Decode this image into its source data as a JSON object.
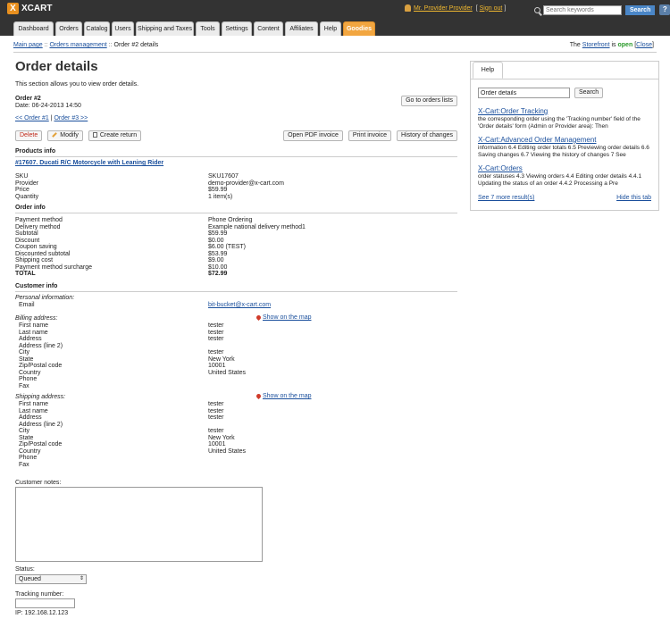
{
  "header": {
    "logo_text": "XCART",
    "user_name": "Mr. Provider Provider",
    "sign_out": "Sign out",
    "search_placeholder": "Search keywords",
    "search_button": "Search",
    "help_icon_label": "?"
  },
  "tabs": [
    "Dashboard",
    "Orders",
    "Catalog",
    "Users",
    "Shipping and Taxes",
    "Tools",
    "Settings",
    "Content",
    "Affiliates",
    "Help",
    "Goodies"
  ],
  "breadcrumb": {
    "main_page": "Main page",
    "sep": "::",
    "orders_management": "Orders management",
    "current": "Order #2 details"
  },
  "storefront": {
    "prefix": "The",
    "link": "Storefront",
    "middle": "is",
    "status": "open",
    "close_label": "Close"
  },
  "page": {
    "title": "Order details",
    "intro": "This section allows you to view order details.",
    "order_number": "Order #2",
    "order_date": "Date: 06-24-2013 14:50",
    "goto_orders": "Go to orders lists",
    "prev_order": "<< Order #1",
    "next_order": "Order #3 >>",
    "nav_sep": "|"
  },
  "actions": {
    "delete": "Delete",
    "modify": "Modify",
    "create_return": "Create return",
    "open_pdf": "Open PDF invoice",
    "print_invoice": "Print invoice",
    "history": "History of changes"
  },
  "products": {
    "section_title": "Products info",
    "product_link": "#17607. Ducati R/C Motorcycle with Leaning Rider",
    "labels": [
      "SKU",
      "Provider",
      "Price",
      "Quantity"
    ],
    "values": [
      "SKU17607",
      "demo-provider@x-cart.com",
      "$59.99",
      "1 item(s)"
    ]
  },
  "order_info": {
    "section_title": "Order info",
    "labels": [
      "Payment method",
      "Delivery method",
      "Subtotal",
      "Discount",
      "Coupon saving",
      "Discounted subtotal",
      "Shipping cost",
      "Payment method surcharge",
      "TOTAL"
    ],
    "values": [
      "Phone Ordering",
      "Example national delivery method1",
      "$59.99",
      "$0.00",
      "$6.00 (TEST)",
      "$53.99",
      "$9.00",
      "$10.00",
      "$72.99"
    ]
  },
  "customer_info": {
    "section_title": "Customer info",
    "personal_label": "Personal information:",
    "email_label": "Email",
    "email_value": "bit-bucket@x-cart.com",
    "billing_label": "Billing address:",
    "shipping_label": "Shipping address:",
    "show_map": "Show on the map",
    "address_labels": [
      "First name",
      "Last name",
      "Address",
      "Address (line 2)",
      "City",
      "State",
      "Zip/Postal code",
      "Country",
      "Phone",
      "Fax"
    ],
    "billing_values": [
      "tester",
      "tester",
      "tester",
      "",
      "tester",
      "New York",
      "10001",
      "United States",
      "",
      ""
    ],
    "shipping_values": [
      "tester",
      "tester",
      "tester",
      "",
      "tester",
      "New York",
      "10001",
      "United States",
      "",
      ""
    ]
  },
  "form": {
    "notes_label": "Customer notes:",
    "status_label": "Status:",
    "status_value": "Queued",
    "tracking_label": "Tracking number:",
    "ip": "IP: 192.168.12.123"
  },
  "help_panel": {
    "tab_label": "Help",
    "search_value": "Order details",
    "search_button": "Search",
    "results": [
      {
        "title": "X-Cart:Order Tracking",
        "snippet": "the corresponding order using the 'Tracking number' field of the 'Order details' form (Admin or Provider area): Then"
      },
      {
        "title": "X-Cart:Advanced Order Management",
        "snippet": "information 6.4 Editing order totals 6.5 Previewing order details 6.6 Saving changes 6.7 Viewing the history of changes 7 See"
      },
      {
        "title": "X-Cart:Orders",
        "snippet": "order statuses 4.3 Viewing orders 4.4 Editing order details 4.4.1 Updating the status of an order 4.4.2 Processing a Pre"
      }
    ],
    "more_results": "See 7 more result(s)",
    "hide_tab": "Hide this tab"
  }
}
